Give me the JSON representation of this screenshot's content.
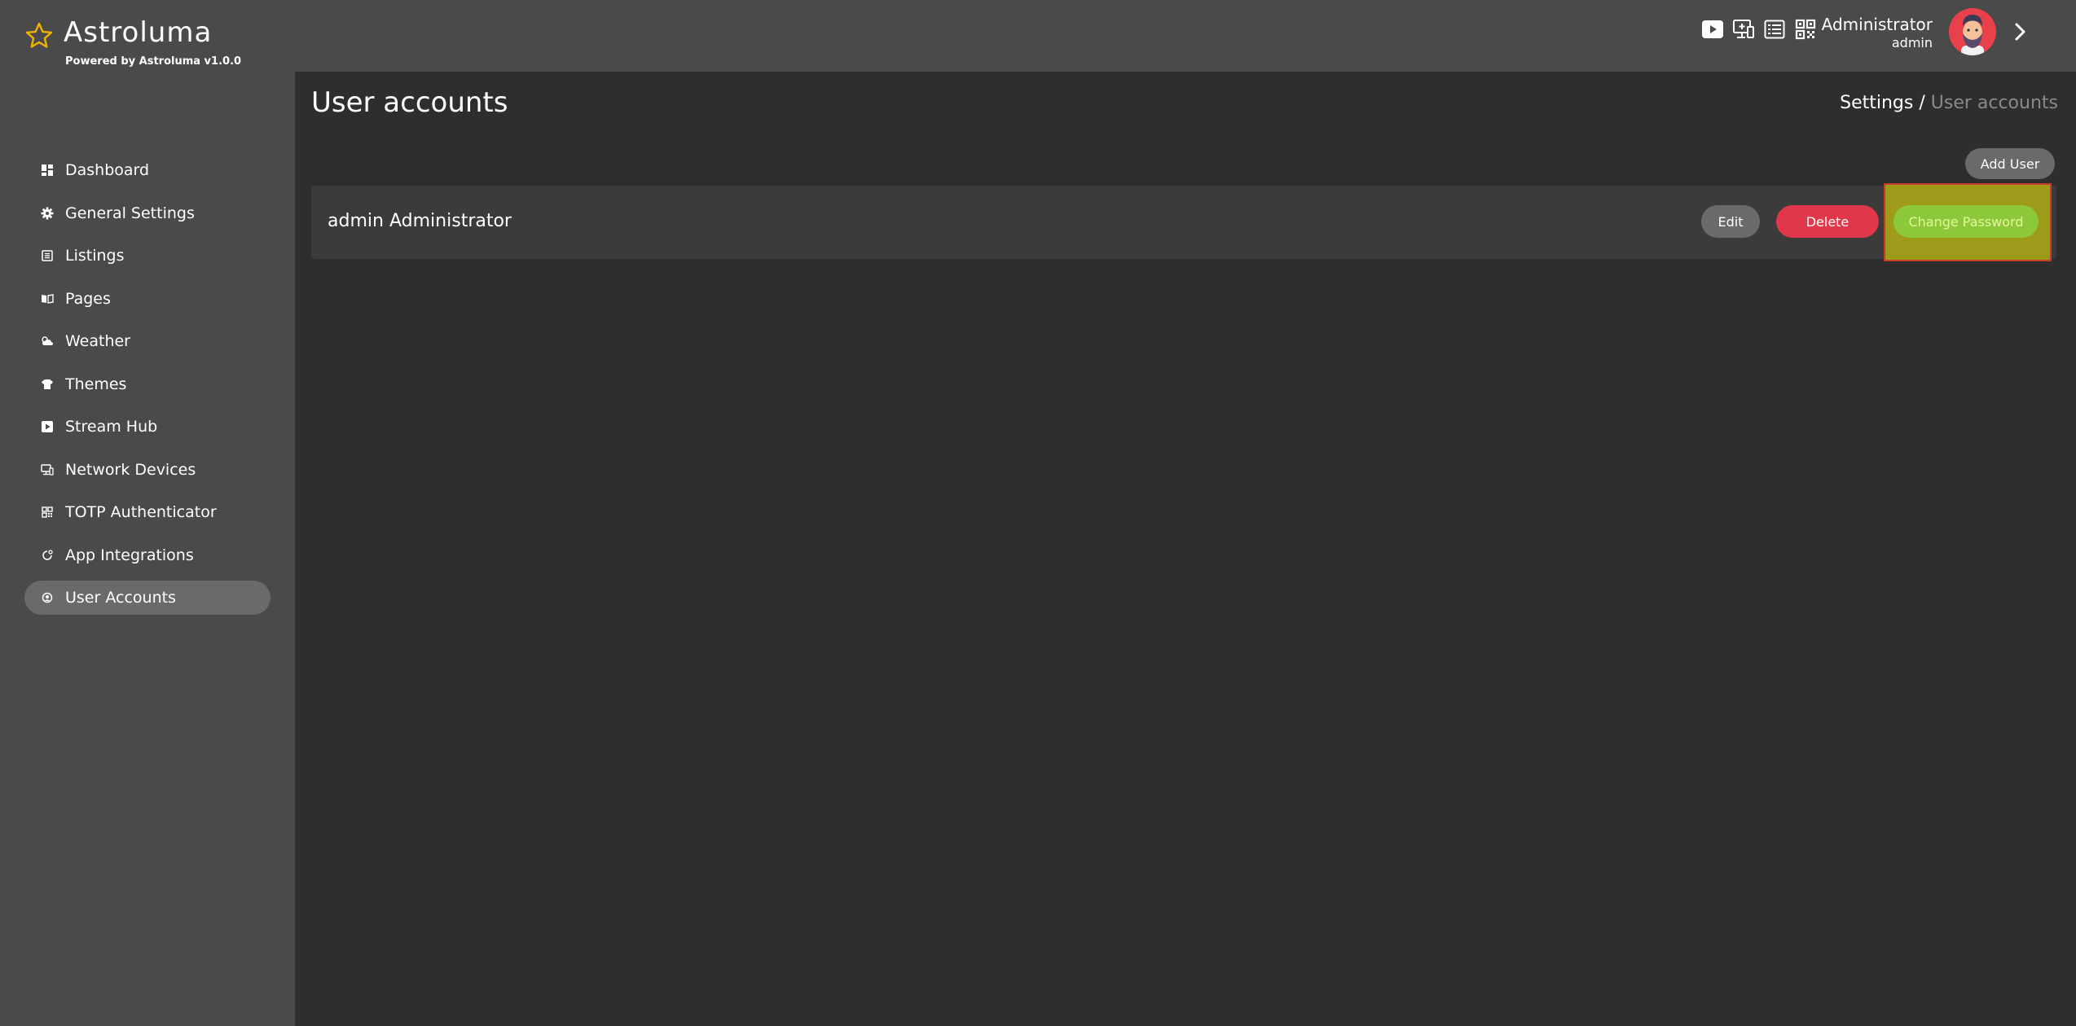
{
  "brand": {
    "name": "Astroluma",
    "powered_by": "Powered by Astroluma v1.0.0",
    "accent_color": "#f0b400"
  },
  "header": {
    "icons": [
      "stream-hub-icon",
      "network-devices-icon",
      "listings-icon",
      "qr-code-icon"
    ],
    "user": {
      "name": "Administrator",
      "login": "admin"
    },
    "avatar_background": "#e8414c"
  },
  "sidebar": {
    "items": [
      {
        "label": "Dashboard",
        "icon": "dashboard-icon",
        "active": false
      },
      {
        "label": "General Settings",
        "icon": "gear-icon",
        "active": false
      },
      {
        "label": "Listings",
        "icon": "listings-icon",
        "active": false
      },
      {
        "label": "Pages",
        "icon": "pages-icon",
        "active": false
      },
      {
        "label": "Weather",
        "icon": "weather-icon",
        "active": false
      },
      {
        "label": "Themes",
        "icon": "shirt-icon",
        "active": false
      },
      {
        "label": "Stream Hub",
        "icon": "play-icon",
        "active": false
      },
      {
        "label": "Network Devices",
        "icon": "network-devices-icon",
        "active": false
      },
      {
        "label": "TOTP Authenticator",
        "icon": "qr-code-icon",
        "active": false
      },
      {
        "label": "App Integrations",
        "icon": "integration-icon",
        "active": false
      },
      {
        "label": "User Accounts",
        "icon": "user-icon",
        "active": true
      }
    ]
  },
  "main": {
    "title": "User accounts",
    "breadcrumb": {
      "parent": "Settings /",
      "current": "User accounts"
    },
    "add_user_label": "Add User",
    "users": [
      {
        "login": "admin",
        "name": "Administrator",
        "edit_label": "Edit",
        "delete_label": "Delete",
        "change_password_label": "Change Password"
      }
    ]
  },
  "colors": {
    "delete": "#e0374a",
    "change_password": "#8cc83a",
    "highlight": "#9e9a1a"
  }
}
